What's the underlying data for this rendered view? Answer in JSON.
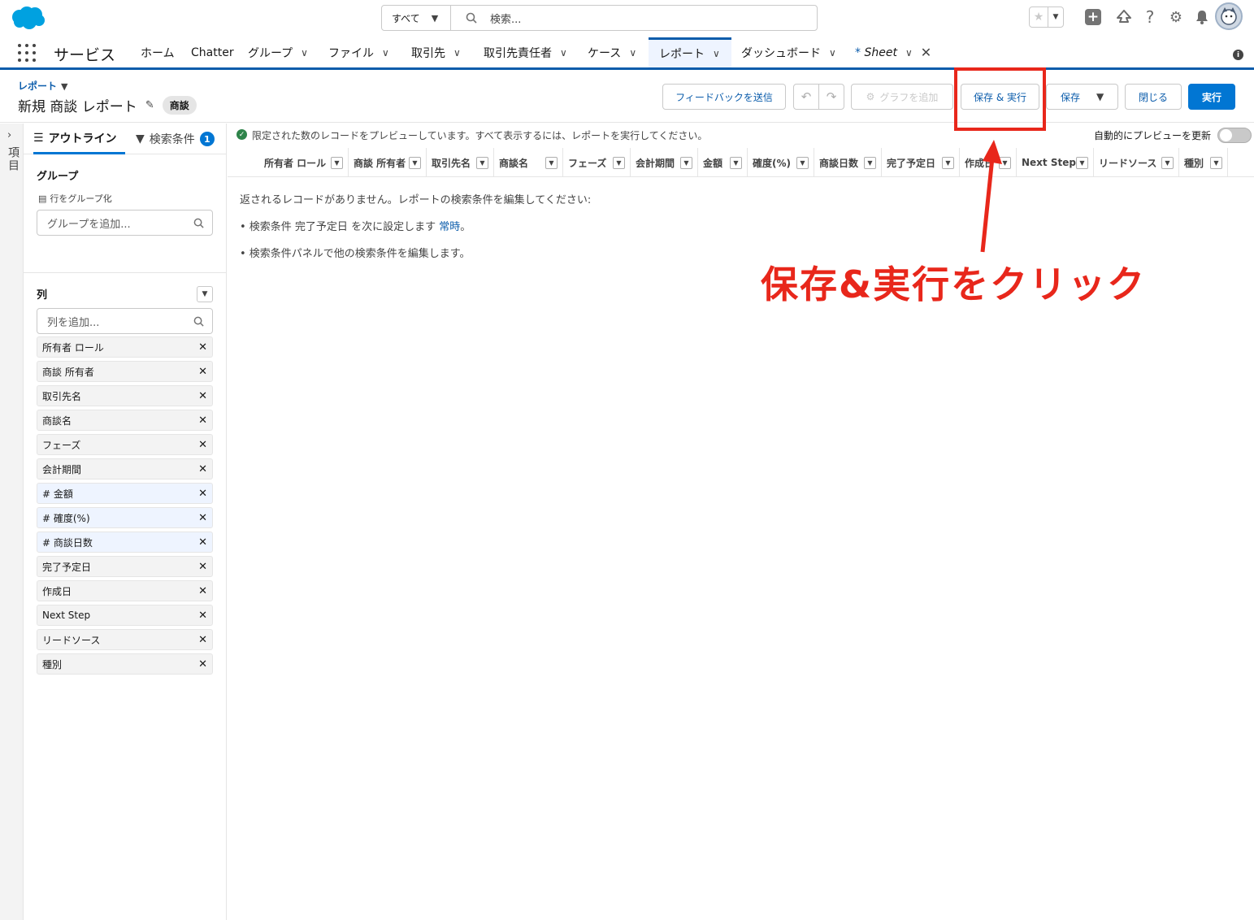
{
  "header": {
    "search_scope": "すべて",
    "search_placeholder": "検索..."
  },
  "nav": {
    "app_name": "サービス",
    "items": [
      {
        "label": "ホーム",
        "dropdown": false
      },
      {
        "label": "Chatter",
        "dropdown": false
      },
      {
        "label": "グループ",
        "dropdown": true
      },
      {
        "label": "ファイル",
        "dropdown": true
      },
      {
        "label": "取引先",
        "dropdown": true
      },
      {
        "label": "取引先責任者",
        "dropdown": true
      },
      {
        "label": "ケース",
        "dropdown": true
      },
      {
        "label": "レポート",
        "dropdown": true,
        "active": true
      },
      {
        "label": "ダッシュボード",
        "dropdown": true
      }
    ],
    "sheet_tab": {
      "star": "*",
      "label": "Sheet"
    }
  },
  "page": {
    "breadcrumb": "レポート",
    "title": "新規 商談 レポート",
    "type_badge": "商談",
    "buttons": {
      "feedback": "フィードバックを送信",
      "add_chart": "グラフを追加",
      "save_run": "保存 & 実行",
      "save": "保存",
      "close": "閉じる",
      "run": "実行"
    }
  },
  "rail": {
    "label": "項目"
  },
  "panel": {
    "tabs": {
      "outline": "アウトライン",
      "filters": "検索条件",
      "filters_count": "1"
    },
    "group": {
      "title": "グループ",
      "subtitle": "行をグループ化",
      "placeholder": "グループを追加..."
    },
    "columns": {
      "title": "列",
      "placeholder": "列を追加...",
      "items": [
        {
          "label": "所有者 ロール",
          "numeric": false
        },
        {
          "label": "商談 所有者",
          "numeric": false
        },
        {
          "label": "取引先名",
          "numeric": false
        },
        {
          "label": "商談名",
          "numeric": false
        },
        {
          "label": "フェーズ",
          "numeric": false
        },
        {
          "label": "会計期間",
          "numeric": false
        },
        {
          "label": "# 金額",
          "numeric": true
        },
        {
          "label": "# 確度(%)",
          "numeric": true
        },
        {
          "label": "# 商談日数",
          "numeric": true
        },
        {
          "label": "完了予定日",
          "numeric": false
        },
        {
          "label": "作成日",
          "numeric": false
        },
        {
          "label": "Next Step",
          "numeric": false
        },
        {
          "label": "リードソース",
          "numeric": false
        },
        {
          "label": "種別",
          "numeric": false
        }
      ]
    }
  },
  "preview": {
    "message": "限定された数のレコードをプレビューしています。すべて表示するには、レポートを実行してください。",
    "auto_refresh_label": "自動的にプレビューを更新",
    "auto_refresh_on": false,
    "columns": [
      "所有者 ロール",
      "商談 所有者",
      "取引先名",
      "商談名",
      "フェーズ",
      "会計期間",
      "金額",
      "確度(%)",
      "商談日数",
      "完了予定日",
      "作成日",
      "Next Step",
      "リードソース",
      "種別"
    ],
    "empty": {
      "line1": "返されるレコードがありません。レポートの検索条件を編集してください:",
      "line2_prefix": "• 検索条件 完了予定日 を次に設定します ",
      "line2_link": "常時",
      "line2_suffix": "。",
      "line3": "• 検索条件パネルで他の検索条件を編集します。"
    }
  },
  "annotation": {
    "text": "保存&実行をクリック",
    "color": "#e8271b"
  },
  "colors": {
    "brand": "#0b5cab",
    "primary_button": "#0176d3",
    "logo": "#00a1e0"
  }
}
